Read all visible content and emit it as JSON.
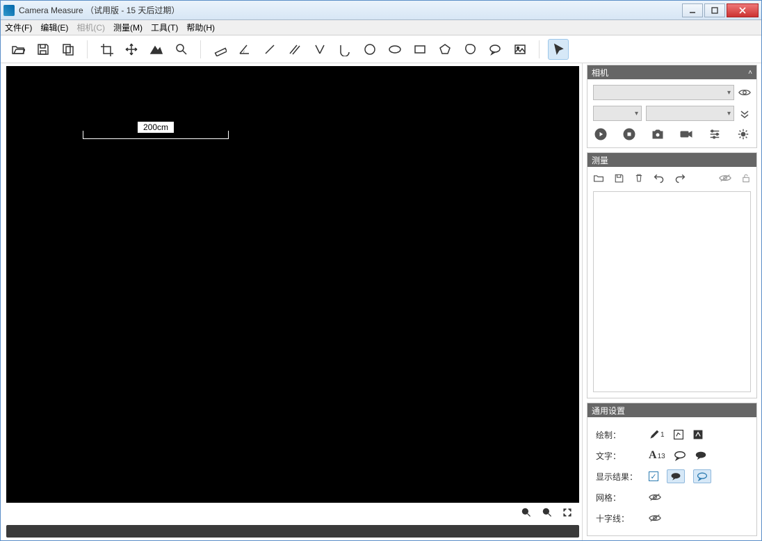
{
  "window": {
    "title": "Camera Measure （试用版 - 15 天后过期）"
  },
  "menubar": {
    "file": "文件(F)",
    "edit": "编辑(E)",
    "camera": "相机(C)",
    "measure": "测量(M)",
    "tools": "工具(T)",
    "help": "帮助(H)"
  },
  "canvas": {
    "dimension_label": "200cm"
  },
  "panels": {
    "camera": {
      "title": "相机"
    },
    "measure": {
      "title": "测量"
    },
    "settings": {
      "title": "通用设置",
      "draw_label": "绘制：",
      "draw_size": "1",
      "text_label": "文字：",
      "text_size": "13",
      "result_label": "显示结果：",
      "grid_label": "网格：",
      "crosshair_label": "十字线："
    }
  }
}
